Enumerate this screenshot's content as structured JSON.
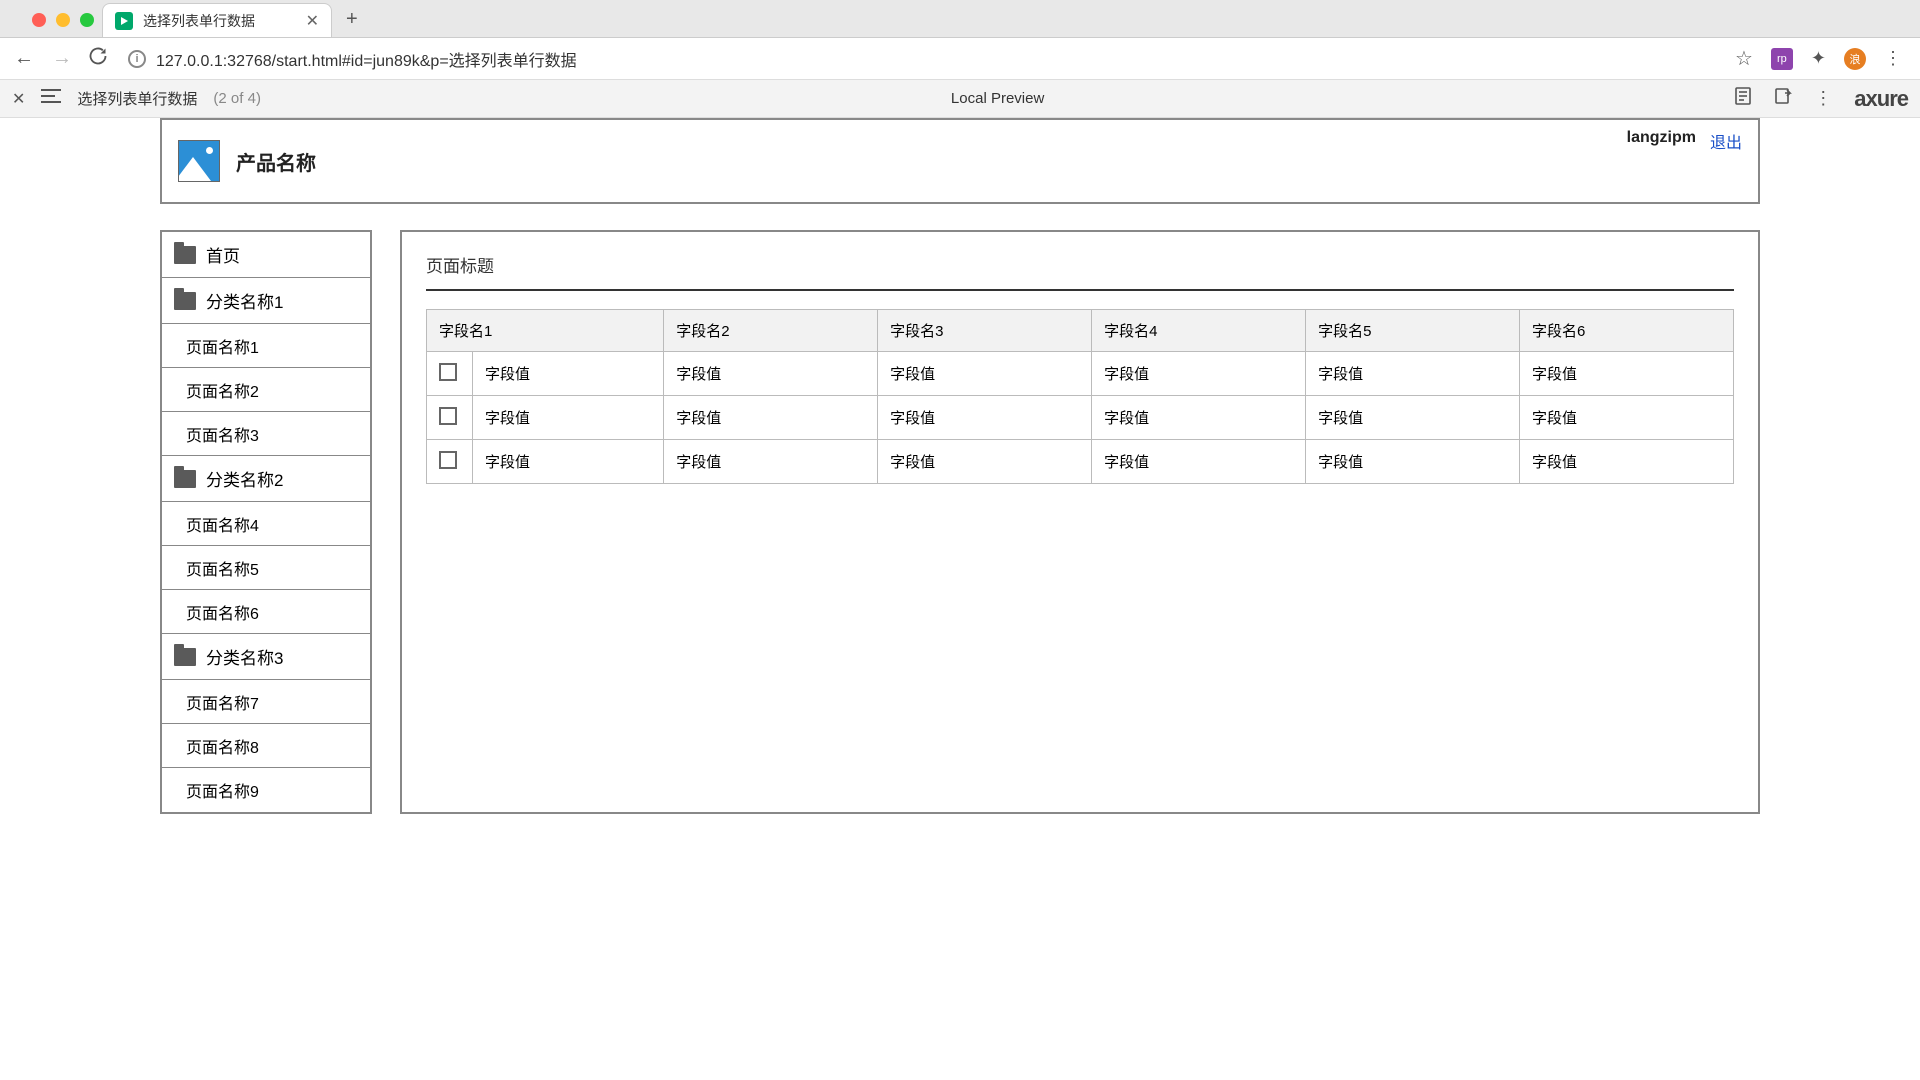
{
  "browser": {
    "tab_title": "选择列表单行数据",
    "url": "127.0.0.1:32768/start.html#id=jun89k&p=选择列表单行数据"
  },
  "axure": {
    "page_name": "选择列表单行数据",
    "page_count": "(2 of 4)",
    "center_label": "Local Preview",
    "logo_text": "axure"
  },
  "header": {
    "product_name": "产品名称",
    "username": "langzipm",
    "logout": "退出"
  },
  "sidebar": {
    "home": "首页",
    "cat1": "分类名称1",
    "p1": "页面名称1",
    "p2": "页面名称2",
    "p3": "页面名称3",
    "cat2": "分类名称2",
    "p4": "页面名称4",
    "p5": "页面名称5",
    "p6": "页面名称6",
    "cat3": "分类名称3",
    "p7": "页面名称7",
    "p8": "页面名称8",
    "p9": "页面名称9"
  },
  "panel": {
    "title": "页面标题"
  },
  "table": {
    "headers": {
      "c1": "字段名1",
      "c2": "字段名2",
      "c3": "字段名3",
      "c4": "字段名4",
      "c5": "字段名5",
      "c6": "字段名6"
    },
    "rows": [
      {
        "c1": "字段值",
        "c2": "字段值",
        "c3": "字段值",
        "c4": "字段值",
        "c5": "字段值",
        "c6": "字段值"
      },
      {
        "c1": "字段值",
        "c2": "字段值",
        "c3": "字段值",
        "c4": "字段值",
        "c5": "字段值",
        "c6": "字段值"
      },
      {
        "c1": "字段值",
        "c2": "字段值",
        "c3": "字段值",
        "c4": "字段值",
        "c5": "字段值",
        "c6": "字段值"
      }
    ]
  }
}
